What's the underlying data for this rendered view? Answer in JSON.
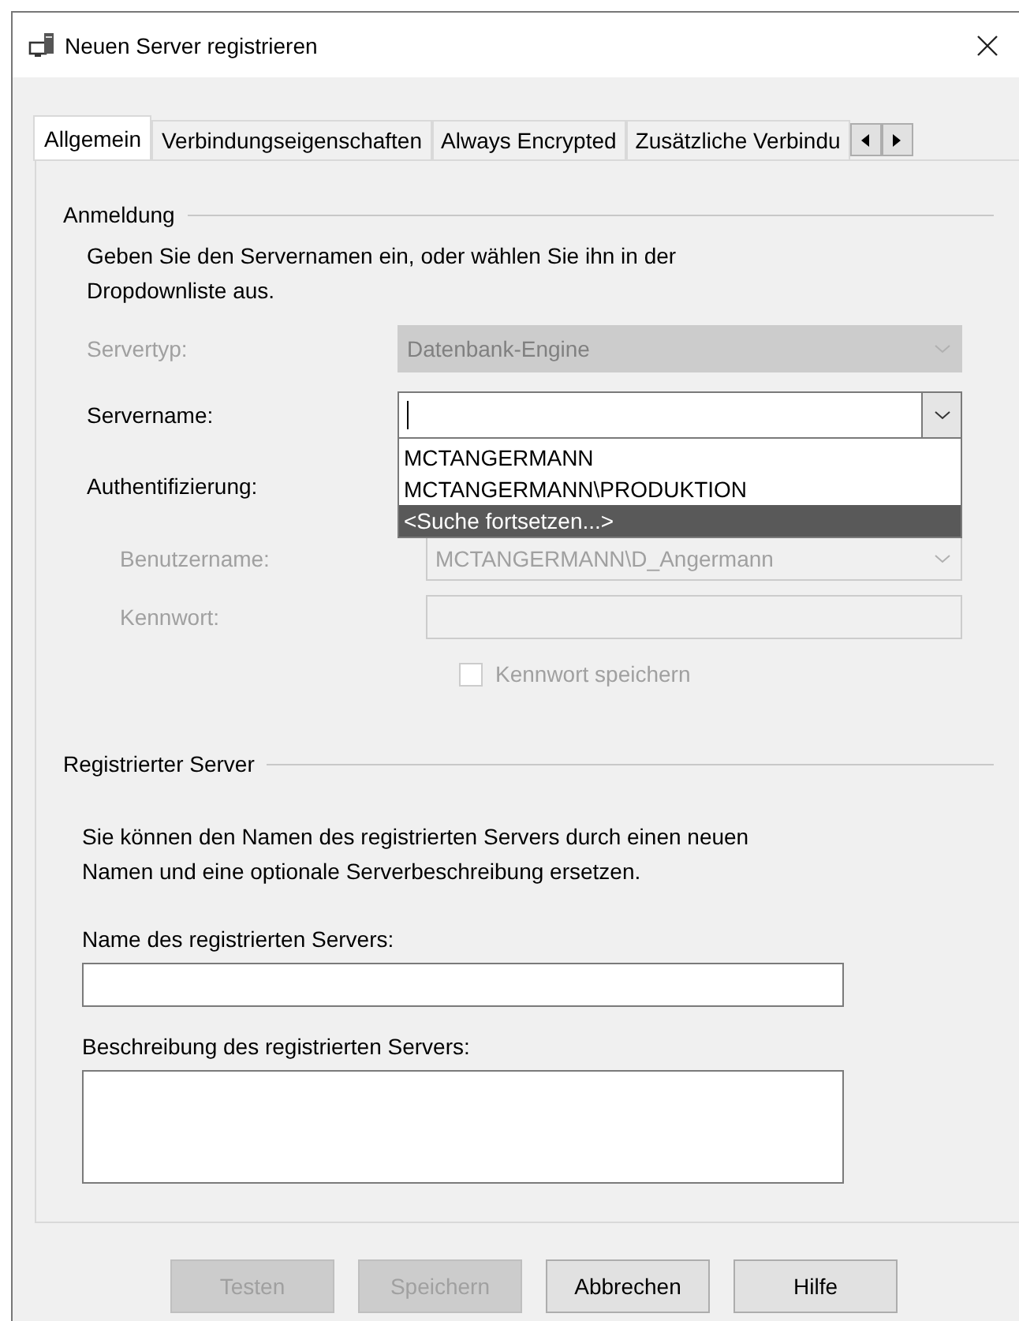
{
  "window": {
    "title": "Neuen Server registrieren"
  },
  "tabs": [
    {
      "label": "Allgemein",
      "selected": true
    },
    {
      "label": "Verbindungseigenschaften",
      "selected": false
    },
    {
      "label": "Always Encrypted",
      "selected": false
    },
    {
      "label": "Zusätzliche Verbindu",
      "selected": false
    }
  ],
  "login": {
    "heading": "Anmeldung",
    "description": "Geben Sie den Servernamen ein, oder wählen Sie ihn in der Dropdownliste aus.",
    "rows": [
      {
        "kind": "dropdown",
        "label": "Servertyp:",
        "value": "Datenbank-Engine",
        "disabled": true
      },
      {
        "kind": "combo",
        "label": "Servername:",
        "disabled": false,
        "expanded": true,
        "options": [
          {
            "label": "MCTANGERMANN",
            "selected": false
          },
          {
            "label": "MCTANGERMANN\\PRODUKTION",
            "selected": false
          },
          {
            "label": "<Suche fortsetzen...>",
            "selected": true
          }
        ]
      },
      {
        "kind": "label",
        "label": "Authentifizierung:",
        "children": [
          {
            "kind": "combo",
            "label": "Benutzername:",
            "value": "MCTANGERMANN\\D_Angermann",
            "disabled": true
          },
          {
            "kind": "text",
            "label": "Kennwort:",
            "disabled": true
          },
          {
            "kind": "checkbox",
            "label": "Kennwort speichern",
            "checked": false,
            "disabled": true
          }
        ]
      }
    ]
  },
  "registered": {
    "heading": "Registrierter Server",
    "description": "Sie können den Namen des registrierten Servers durch einen neuen Namen und eine optionale Serverbeschreibung ersetzen.",
    "fields": [
      {
        "kind": "text",
        "label": "Name des registrierten Servers:"
      },
      {
        "kind": "textarea",
        "label": "Beschreibung des registrierten Servers:"
      }
    ]
  },
  "buttons": [
    {
      "label": "Testen",
      "disabled": true
    },
    {
      "label": "Speichern",
      "disabled": true
    },
    {
      "label": "Abbrechen",
      "disabled": false
    },
    {
      "label": "Hilfe",
      "disabled": false
    }
  ]
}
